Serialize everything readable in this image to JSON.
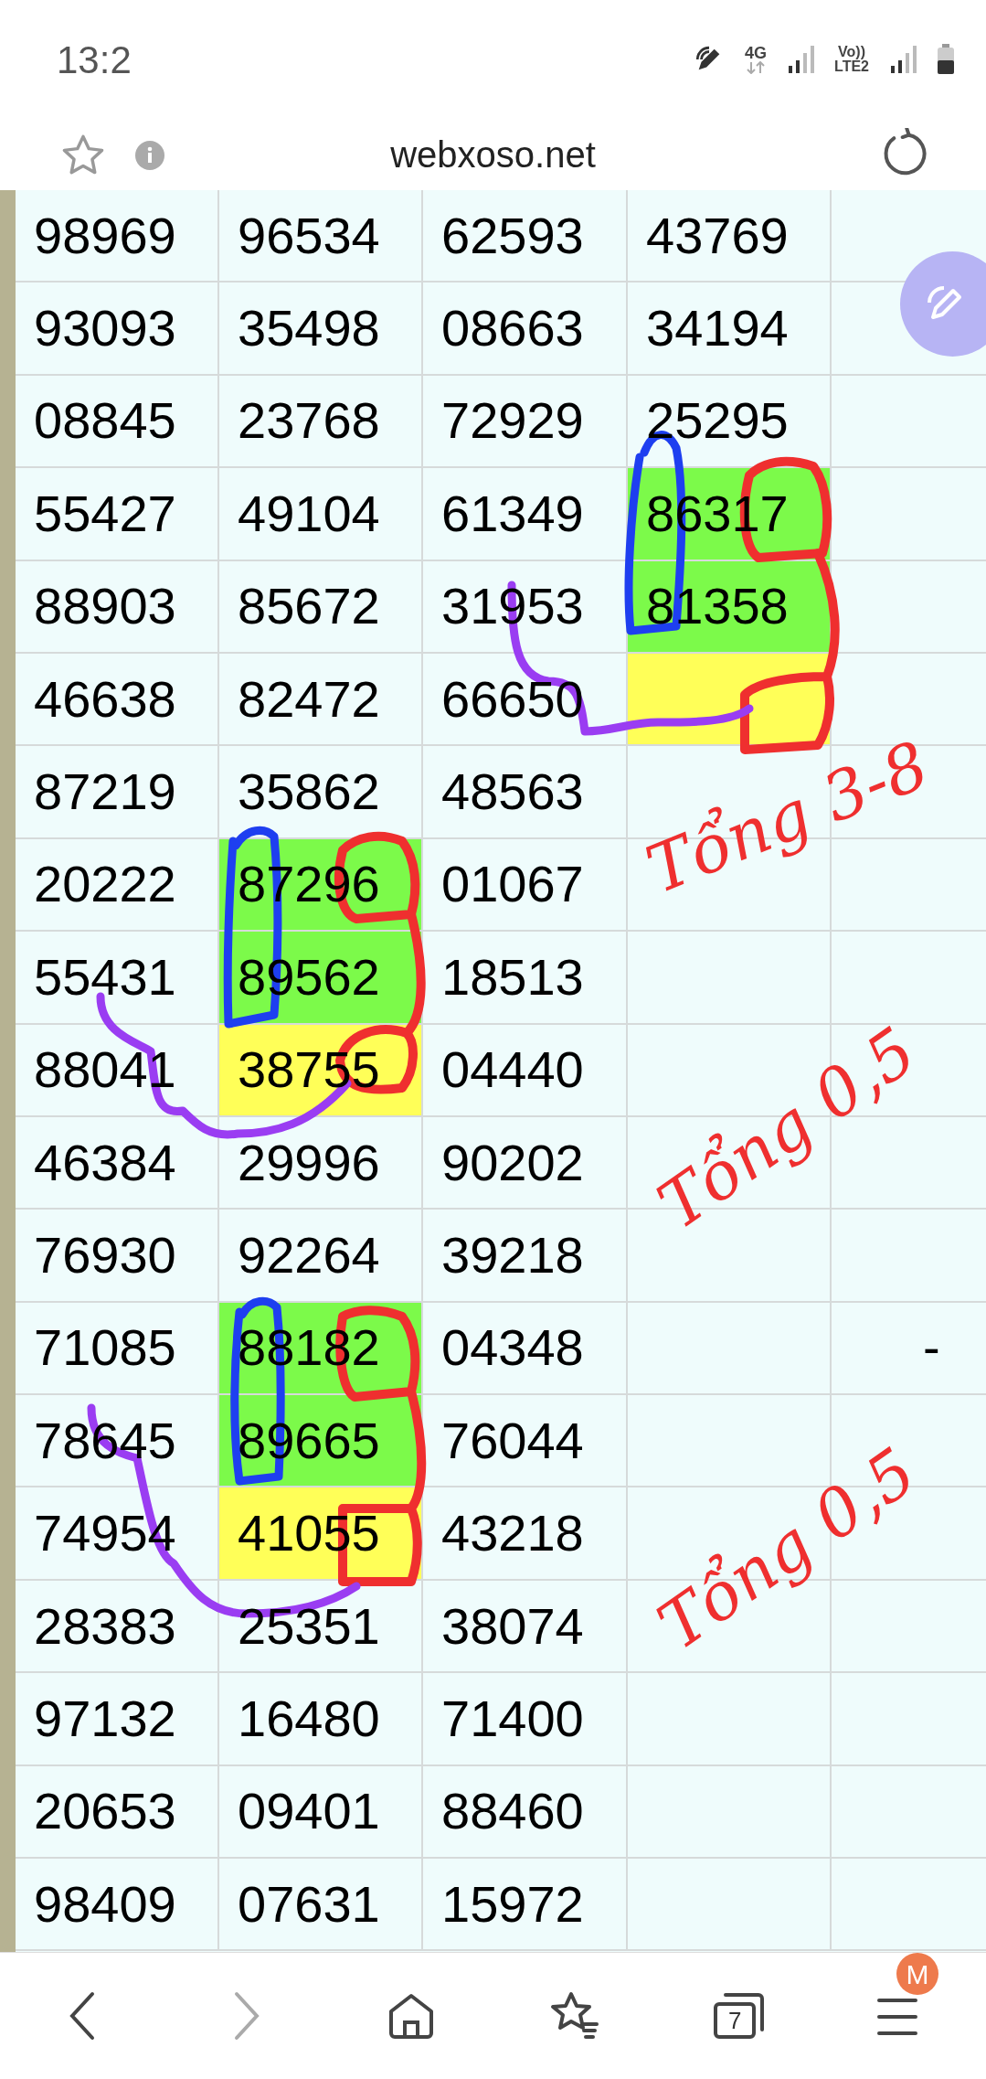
{
  "status_bar": {
    "time": "13:2",
    "network": "4G",
    "volte": "Vo))",
    "lte": "LTE2"
  },
  "address_bar": {
    "url": "webxoso.net"
  },
  "table": {
    "rows": [
      {
        "cells": [
          {
            "text": "98969"
          },
          {
            "text": "96534"
          },
          {
            "text": "62593"
          },
          {
            "text": "43769"
          }
        ]
      },
      {
        "cells": [
          {
            "text": "93093"
          },
          {
            "text": "35498"
          },
          {
            "text": "08663"
          },
          {
            "text": "34194"
          }
        ]
      },
      {
        "cells": [
          {
            "text": "08845"
          },
          {
            "text": "23768"
          },
          {
            "text": "72929"
          },
          {
            "text": "25295"
          }
        ]
      },
      {
        "cells": [
          {
            "text": "55427"
          },
          {
            "text": "49104"
          },
          {
            "text": "61349"
          },
          {
            "text": "86317",
            "color": "#7cfa4a"
          }
        ]
      },
      {
        "cells": [
          {
            "text": "88903"
          },
          {
            "text": "85672"
          },
          {
            "text": "31953"
          },
          {
            "text": "81358",
            "color": "#7cfa4a"
          }
        ]
      },
      {
        "cells": [
          {
            "text": "46638"
          },
          {
            "text": "82472"
          },
          {
            "text": "66650"
          },
          {
            "color": "#ffff58"
          }
        ]
      },
      {
        "cells": [
          {
            "text": "87219"
          },
          {
            "text": "35862"
          },
          {
            "text": "48563"
          }
        ]
      },
      {
        "cells": [
          {
            "text": "20222"
          },
          {
            "text": "87296",
            "color": "#7cfa4a"
          },
          {
            "text": "01067"
          }
        ]
      },
      {
        "cells": [
          {
            "text": "55431"
          },
          {
            "text": "89562",
            "color": "#7cfa4a"
          },
          {
            "text": "18513"
          }
        ]
      },
      {
        "cells": [
          {
            "text": "88041"
          },
          {
            "text": "38755",
            "color": "#ffff58"
          },
          {
            "text": "04440"
          }
        ]
      },
      {
        "cells": [
          {
            "text": "46384"
          },
          {
            "text": "29996"
          },
          {
            "text": "90202"
          }
        ]
      },
      {
        "cells": [
          {
            "text": "76930"
          },
          {
            "text": "92264"
          },
          {
            "text": "39218"
          }
        ]
      },
      {
        "cells": [
          {
            "text": "71085"
          },
          {
            "text": "88182",
            "color": "#7cfa4a"
          },
          {
            "text": "04348"
          },
          {},
          {
            "text": "-"
          }
        ]
      },
      {
        "cells": [
          {
            "text": "78645"
          },
          {
            "text": "89665",
            "color": "#7cfa4a"
          },
          {
            "text": "76044"
          }
        ]
      },
      {
        "cells": [
          {
            "text": "74954"
          },
          {
            "text": "41055",
            "color": "#ffff58"
          },
          {
            "text": "43218"
          }
        ]
      },
      {
        "cells": [
          {
            "text": "28383"
          },
          {
            "text": "25351"
          },
          {
            "text": "38074"
          }
        ]
      },
      {
        "cells": [
          {
            "text": "97132"
          },
          {
            "text": "16480"
          },
          {
            "text": "71400"
          }
        ]
      },
      {
        "cells": [
          {
            "text": "20653"
          },
          {
            "text": "09401"
          },
          {
            "text": "88460"
          }
        ]
      },
      {
        "cells": [
          {
            "text": "98409"
          },
          {
            "text": "07631"
          },
          {
            "text": "15972"
          }
        ]
      }
    ]
  },
  "annotations": [
    {
      "text": "Tổng 3-8"
    },
    {
      "text": "Tổng 0,5"
    },
    {
      "text": "Tổng 0,5"
    }
  ],
  "bottom_bar": {
    "tab_count": "7",
    "profile_badge": "M"
  }
}
